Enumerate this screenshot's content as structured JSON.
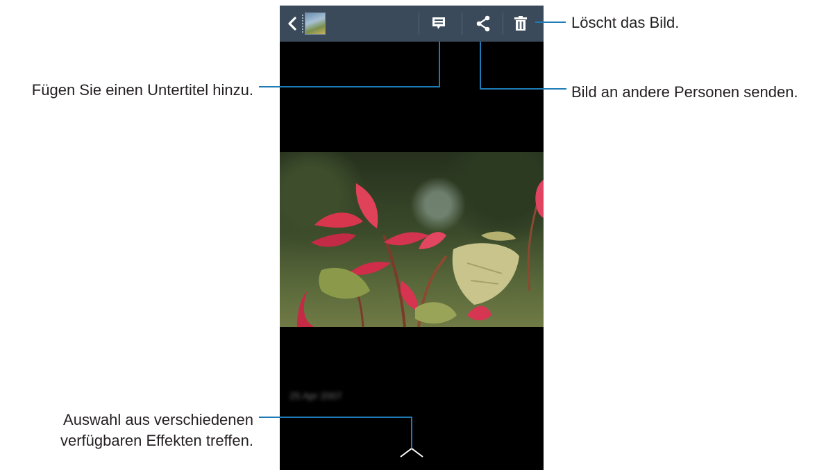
{
  "callouts": {
    "delete": "Löscht das Bild.",
    "caption": "Fügen Sie einen Untertitel hinzu.",
    "share": "Bild an andere Personen senden.",
    "effects_line1": "Auswahl aus verschiedenen",
    "effects_line2": "verfügbaren Effekten treffen."
  },
  "actionbar": {
    "icons": [
      "back-icon",
      "album-thumbnail",
      "caption-icon",
      "share-icon",
      "trash-icon"
    ]
  },
  "colors": {
    "callout_line": "#1f7bb6",
    "actionbar_bg": "#3a4a5a",
    "screen_bg": "#000000",
    "icon": "#ffffff"
  }
}
